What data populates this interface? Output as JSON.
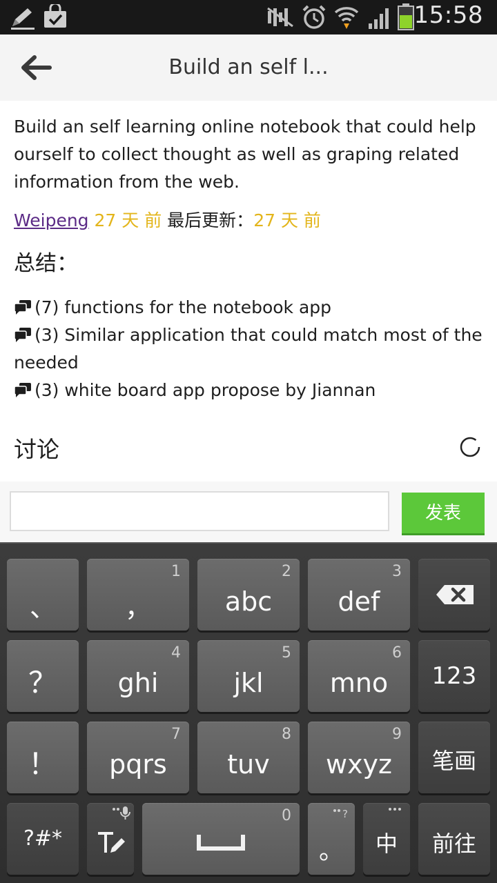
{
  "status_bar": {
    "time": "15:58",
    "icons": [
      "edit-icon",
      "shopping-bag-icon",
      "mute-icon",
      "alarm-icon",
      "wifi-icon",
      "signal-icon",
      "battery-icon"
    ]
  },
  "header": {
    "title": "Build an self l...",
    "back_icon": "back-arrow-icon"
  },
  "post": {
    "description": "Build an self learning online notebook that could help ourself to collect thought as well as graping related information from the web.",
    "author": "Weipeng",
    "created_ago": "27 天 前",
    "last_updated_label": "最后更新：",
    "updated_ago": "27 天 前"
  },
  "summary": {
    "heading": "总结：",
    "items": [
      "(7) functions for the notebook app",
      "(3) Similar application that could match most of the needed",
      "(3) white board app propose by Jiannan"
    ]
  },
  "discussion": {
    "heading": "讨论"
  },
  "comment": {
    "value": "",
    "post_label": "发表"
  },
  "keyboard": {
    "keys": {
      "k_dunhao": "、",
      "k_comma": "，",
      "k_comma_num": "1",
      "k_abc": "abc",
      "k_abc_num": "2",
      "k_def": "def",
      "k_def_num": "3",
      "k_question": "？",
      "k_ghi": "ghi",
      "k_ghi_num": "4",
      "k_jkl": "jkl",
      "k_jkl_num": "5",
      "k_mno": "mno",
      "k_mno_num": "6",
      "k_123": "123",
      "k_exclaim": "！",
      "k_pqrs": "pqrs",
      "k_pqrs_num": "7",
      "k_tuv": "tuv",
      "k_tuv_num": "8",
      "k_wxyz": "wxyz",
      "k_wxyz_num": "9",
      "k_stroke": "笔画",
      "k_symbols": "?#*",
      "k_space_num": "0",
      "k_period": "。",
      "k_chinese": "中",
      "k_go": "前往"
    },
    "colors": {
      "key": "#626262",
      "dark_key": "#444444",
      "accent_button": "#5cc83a"
    }
  }
}
